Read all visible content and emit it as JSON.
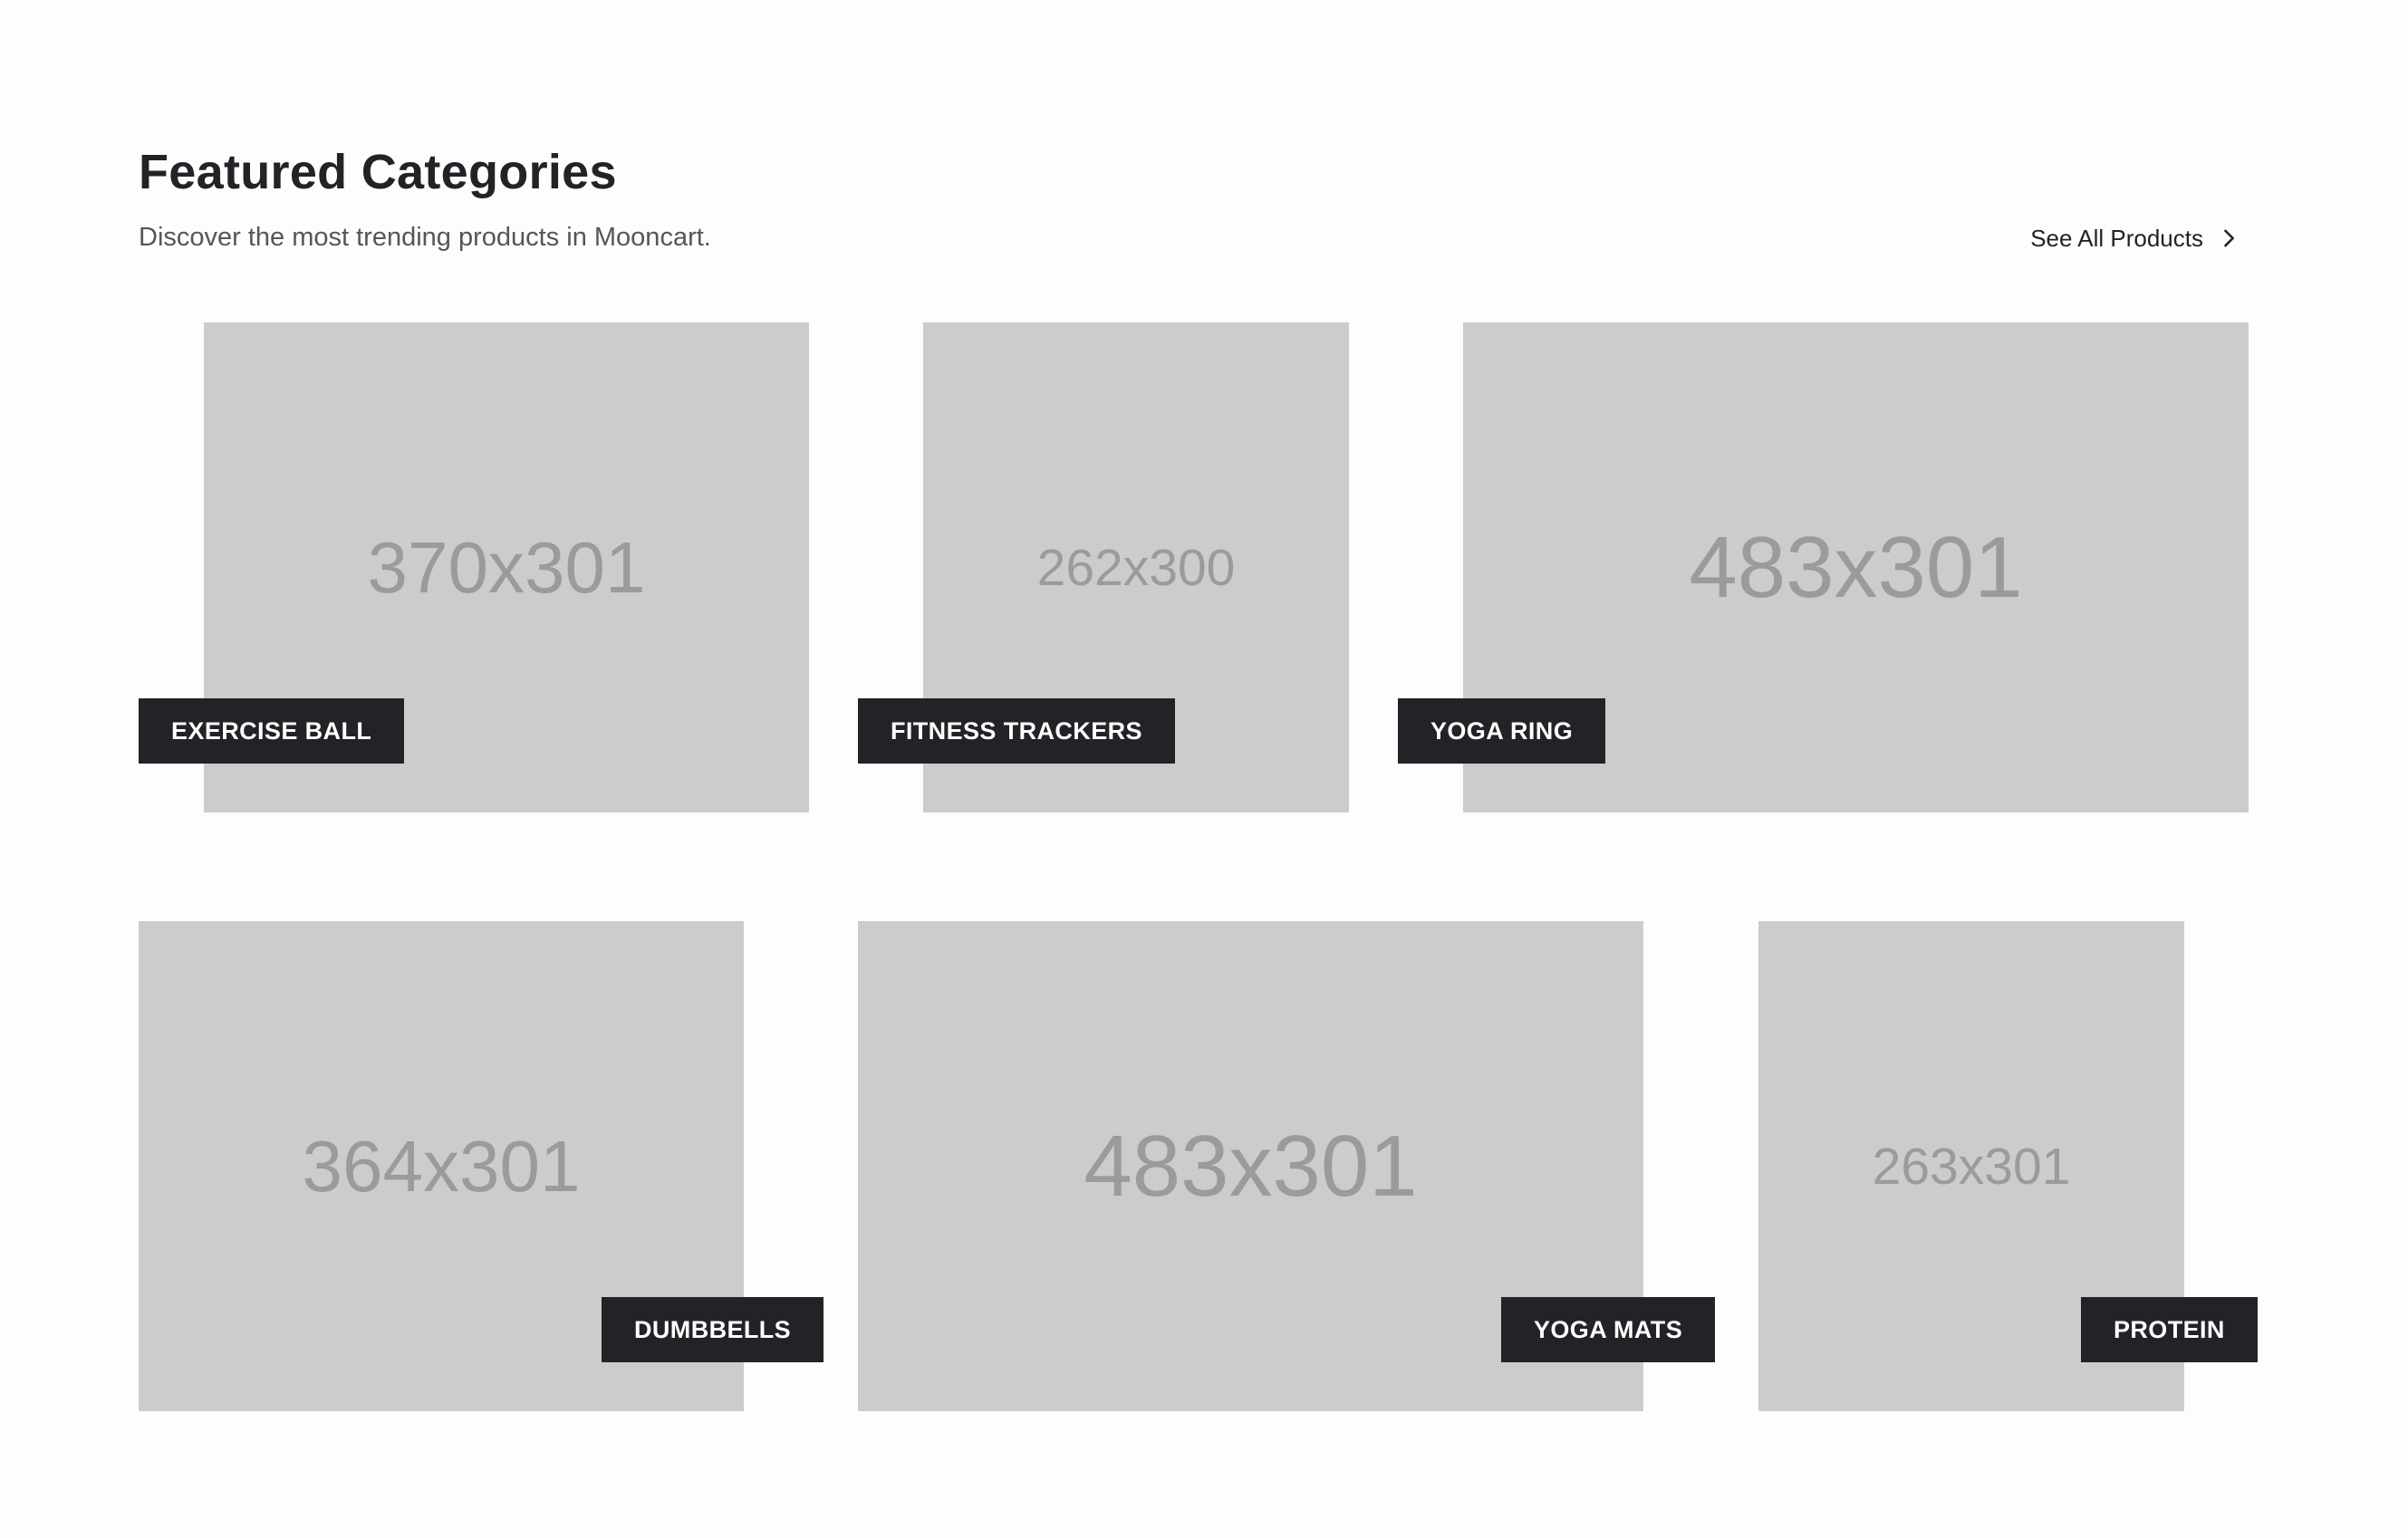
{
  "header": {
    "title": "Featured Categories",
    "subtitle": "Discover the most trending products in Mooncart.",
    "see_all_label": "See All Products",
    "see_all_icon": "chevron-right-icon"
  },
  "colors": {
    "background": "#fdfdfd",
    "placeholder": "#cccccc",
    "placeholder_text": "#9b9b9b",
    "tag_background": "#222326",
    "tag_text": "#ffffff"
  },
  "categories": [
    {
      "label": "EXERCISE BALL",
      "image_text": "370x301"
    },
    {
      "label": "FITNESS TRACKERS",
      "image_text": "262x300"
    },
    {
      "label": "YOGA RING",
      "image_text": "483x301"
    },
    {
      "label": "DUMBBELLS",
      "image_text": "364x301"
    },
    {
      "label": "YOGA MATS",
      "image_text": "483x301"
    },
    {
      "label": "PROTEIN",
      "image_text": "263x301"
    }
  ]
}
